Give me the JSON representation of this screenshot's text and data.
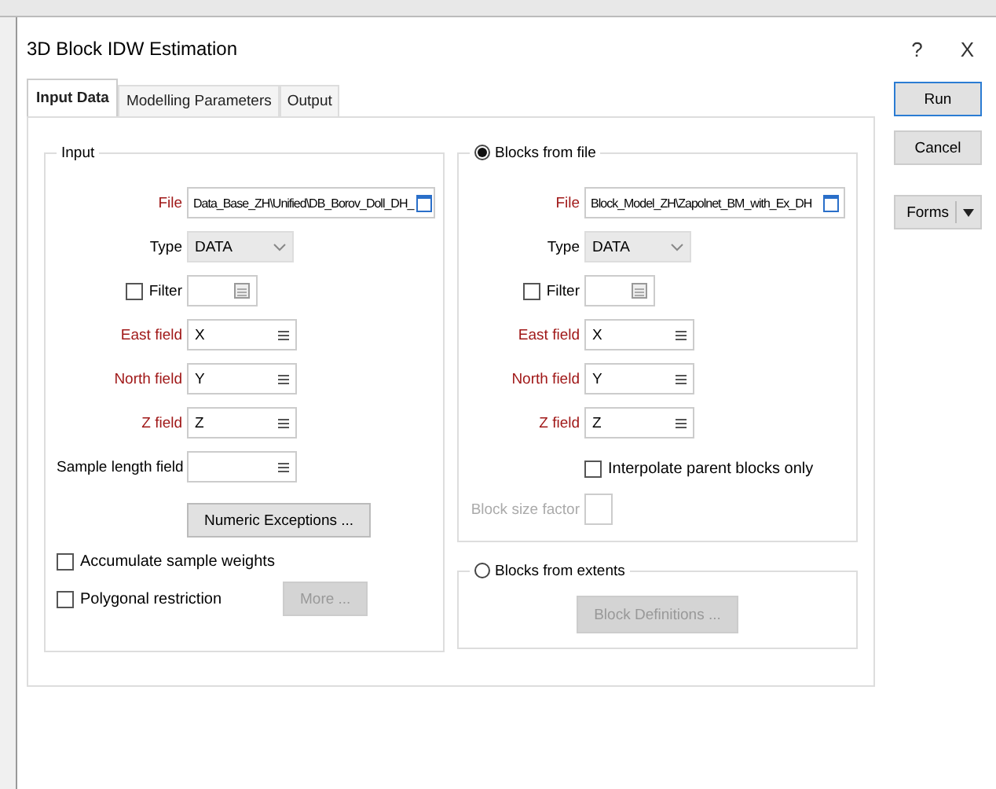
{
  "window": {
    "title": "3D Block IDW Estimation",
    "help": "?",
    "close": "X"
  },
  "tabs": [
    {
      "label": "Input Data",
      "selected": true
    },
    {
      "label": "Modelling Parameters",
      "selected": false
    },
    {
      "label": "Output",
      "selected": false
    }
  ],
  "input_group": {
    "title": "Input",
    "rows": [
      {
        "kind": "file",
        "label": "File",
        "value": "Data_Base_ZH\\Unified\\DB_Borov_Doll_DH_",
        "required": true
      },
      {
        "kind": "select",
        "label": "Type",
        "value": "DATA",
        "required": false
      },
      {
        "kind": "filter",
        "label": "Filter",
        "checked": false
      },
      {
        "kind": "field",
        "label": "East field",
        "value": "X",
        "required": true
      },
      {
        "kind": "field",
        "label": "North field",
        "value": "Y",
        "required": true
      },
      {
        "kind": "field",
        "label": "Z field",
        "value": "Z",
        "required": true
      },
      {
        "kind": "field",
        "label": "Sample length field",
        "required": false
      },
      {
        "kind": "button",
        "label": "Numeric Exceptions ...",
        "disabled": false
      }
    ],
    "options": [
      {
        "label": "Accumulate sample weights",
        "checked": false
      },
      {
        "label": "Polygonal restriction",
        "checked": false,
        "button": {
          "label": "More ...",
          "disabled": true
        }
      }
    ]
  },
  "blocks_from_file": {
    "title": "Blocks from file",
    "selected": true,
    "rows": [
      {
        "kind": "file",
        "label": "File",
        "value": "Block_Model_ZH\\Zapolnet_BM_with_Ex_DH",
        "required": true
      },
      {
        "kind": "select",
        "label": "Type",
        "value": "DATA",
        "required": false
      },
      {
        "kind": "filter",
        "label": "Filter",
        "checked": false
      },
      {
        "kind": "field",
        "label": "East field",
        "value": "X",
        "required": true
      },
      {
        "kind": "field",
        "label": "North field",
        "value": "Y",
        "required": true
      },
      {
        "kind": "field",
        "label": "Z field",
        "value": "Z",
        "required": true
      },
      {
        "kind": "check",
        "label": "Interpolate parent blocks only",
        "checked": false
      },
      {
        "kind": "number",
        "label": "Block size factor",
        "disabled": true
      }
    ]
  },
  "blocks_from_extents": {
    "title": "Blocks from extents",
    "selected": false,
    "button": {
      "label": "Block Definitions ...",
      "disabled": true
    }
  },
  "side_buttons": [
    {
      "kind": "default",
      "label": "Run"
    },
    {
      "kind": "plain",
      "label": "Cancel"
    },
    {
      "kind": "menu",
      "label": "Forms"
    }
  ]
}
